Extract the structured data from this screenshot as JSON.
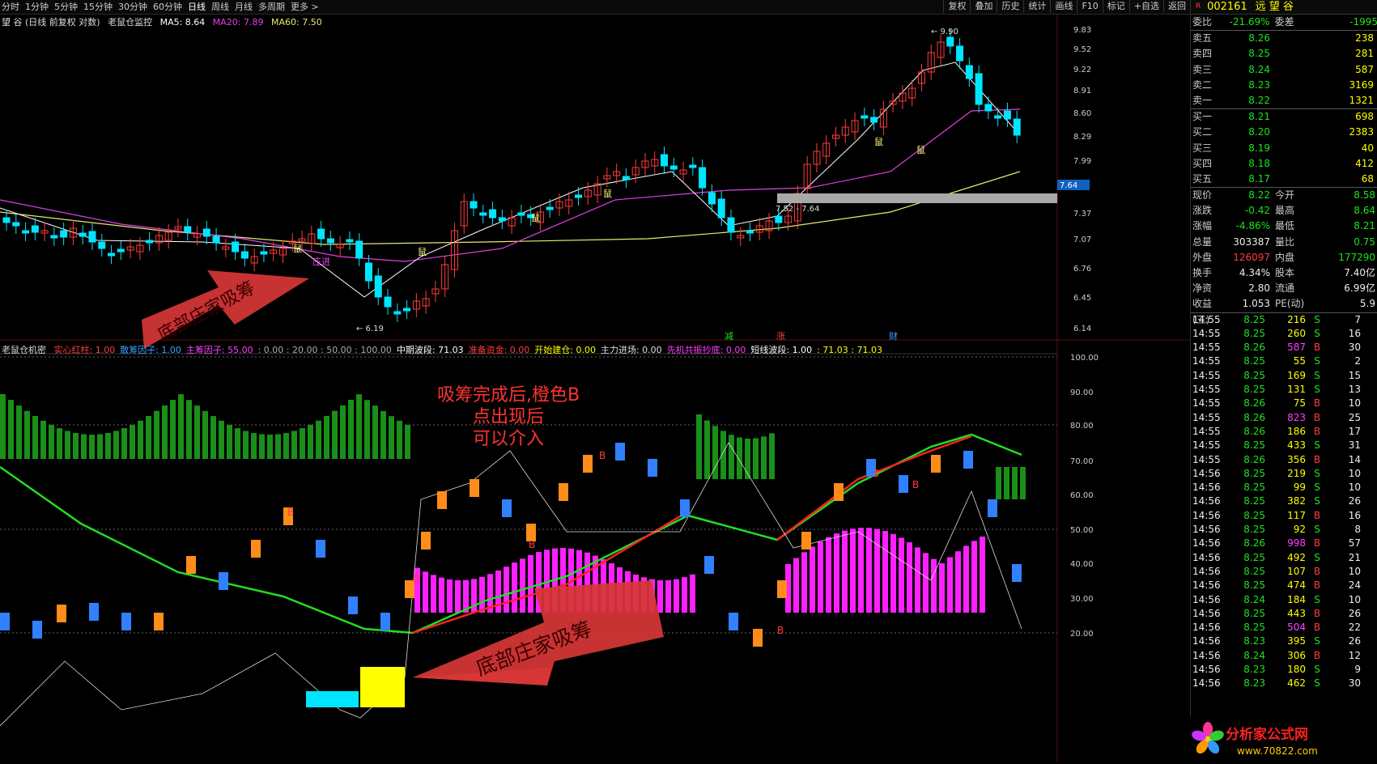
{
  "toolbar": {
    "tabs": [
      "分时",
      "1分钟",
      "5分钟",
      "15分钟",
      "30分钟",
      "60分钟",
      "日线",
      "周线",
      "月线",
      "多周期",
      "更多 >"
    ],
    "active_tab": "日线",
    "tools": [
      "复权",
      "叠加",
      "历史",
      "统计",
      "画线",
      "F10",
      "标记",
      "+自选",
      "返回"
    ]
  },
  "info": {
    "title": "望 谷 (日线 前复权 对数)",
    "indicator": "老鼠仓监控",
    "ma5": "MA5: 8.64",
    "ma20": "MA20: 7.89",
    "ma60": "MA60: 7.50"
  },
  "sub_info": {
    "name": "老鼠仓机密",
    "items": [
      {
        "t": "实心红柱: 1.00",
        "c": "#ff3c3c"
      },
      {
        "t": "散筹因子: 1.00",
        "c": "#3aa0ff"
      },
      {
        "t": "主筹因子: 55.00",
        "c": "#ff3cff"
      },
      {
        "t": ": 0.00 : 20.00 : 50.00 : 100.00",
        "c": "#aaaaaa"
      },
      {
        "t": "中期波段: 71.03",
        "c": "#ffffff"
      },
      {
        "t": "准备资金: 0.00",
        "c": "#ff3c3c"
      },
      {
        "t": "开始建仓: 0.00",
        "c": "#ffff00"
      },
      {
        "t": "主力进场: 0.00",
        "c": "#dddddd"
      },
      {
        "t": "先机共振抄底: 0.00",
        "c": "#ff3cff"
      },
      {
        "t": "短线波段: 1.00",
        "c": "#ffffff"
      },
      {
        "t": ": 71.03 : 71.03",
        "c": "#ffff00"
      }
    ]
  },
  "annotations": {
    "arrow1_text": "底部庄家吸筹",
    "arrow2_text": "底部庄家吸筹",
    "note_lines": [
      "吸筹完成后,橙色B",
      "点出现后",
      "可以介入"
    ]
  },
  "markers": {
    "rat": "鼠",
    "zhuang": "庄进",
    "low_price": "6.19",
    "high_price": "9.90",
    "range_text": "7.52 - 7.64",
    "jian": "减",
    "zhang": "涨",
    "cai": "财",
    "b": "B",
    "price_tag": "7.64"
  },
  "price_axis": [
    "9.83",
    "9.52",
    "9.22",
    "8.91",
    "8.60",
    "8.29",
    "7.99",
    "7.37",
    "7.07",
    "6.76",
    "6.45",
    "6.14"
  ],
  "ind_axis": [
    "100.00",
    "90.00",
    "80.00",
    "70.00",
    "60.00",
    "50.00",
    "40.00",
    "30.00",
    "20.00"
  ],
  "colors": {
    "up": "#ff3c3c",
    "down": "#00e5ff",
    "ma5": "#ffffff",
    "ma20": "#e040e0",
    "ma60": "#e8e870"
  },
  "quote": {
    "code": "002161",
    "name": "远 望 谷",
    "flag": "R",
    "weibi": {
      "label": "委比",
      "value": "-21.69%",
      "label2": "委差",
      "value2": "-1995"
    },
    "asks": [
      {
        "label": "卖五",
        "price": "8.26",
        "vol": "238"
      },
      {
        "label": "卖四",
        "price": "8.25",
        "vol": "281"
      },
      {
        "label": "卖三",
        "price": "8.24",
        "vol": "587"
      },
      {
        "label": "卖二",
        "price": "8.23",
        "vol": "3169"
      },
      {
        "label": "卖一",
        "price": "8.22",
        "vol": "1321"
      }
    ],
    "bids": [
      {
        "label": "买一",
        "price": "8.21",
        "vol": "698"
      },
      {
        "label": "买二",
        "price": "8.20",
        "vol": "2383"
      },
      {
        "label": "买三",
        "price": "8.19",
        "vol": "40"
      },
      {
        "label": "买四",
        "price": "8.18",
        "vol": "412"
      },
      {
        "label": "买五",
        "price": "8.17",
        "vol": "68"
      }
    ],
    "stats": [
      [
        {
          "l": "现价",
          "v": "8.22",
          "c": "g"
        },
        {
          "l": "今开",
          "v": "8.58",
          "c": "g"
        }
      ],
      [
        {
          "l": "涨跌",
          "v": "-0.42",
          "c": "g"
        },
        {
          "l": "最高",
          "v": "8.64",
          "c": "g"
        }
      ],
      [
        {
          "l": "涨幅",
          "v": "-4.86%",
          "c": "g"
        },
        {
          "l": "最低",
          "v": "8.21",
          "c": "g"
        }
      ],
      [
        {
          "l": "总量",
          "v": "303387",
          "c": "w"
        },
        {
          "l": "量比",
          "v": "0.75",
          "c": "g"
        }
      ],
      [
        {
          "l": "外盘",
          "v": "126097",
          "c": "r"
        },
        {
          "l": "内盘",
          "v": "177290",
          "c": "g"
        }
      ],
      [
        {
          "l": "换手",
          "v": "4.34%",
          "c": "w"
        },
        {
          "l": "股本",
          "v": "7.40亿",
          "c": "w"
        }
      ],
      [
        {
          "l": "净资",
          "v": "2.80",
          "c": "w"
        },
        {
          "l": "流通",
          "v": "6.99亿",
          "c": "w"
        }
      ],
      [
        {
          "l": "收益(三)",
          "v": "1.053",
          "c": "w"
        },
        {
          "l": "PE(动)",
          "v": "5.9",
          "c": "w"
        }
      ]
    ],
    "ticks": [
      [
        "14:55",
        "8.25",
        "216",
        "S",
        "7"
      ],
      [
        "14:55",
        "8.25",
        "260",
        "S",
        "16"
      ],
      [
        "14:55",
        "8.26",
        "587",
        "B",
        "30"
      ],
      [
        "14:55",
        "8.25",
        "55",
        "S",
        "2"
      ],
      [
        "14:55",
        "8.25",
        "169",
        "S",
        "15"
      ],
      [
        "14:55",
        "8.25",
        "131",
        "S",
        "13"
      ],
      [
        "14:55",
        "8.26",
        "75",
        "B",
        "10"
      ],
      [
        "14:55",
        "8.26",
        "823",
        "B",
        "25"
      ],
      [
        "14:55",
        "8.26",
        "186",
        "B",
        "17"
      ],
      [
        "14:55",
        "8.25",
        "433",
        "S",
        "31"
      ],
      [
        "14:55",
        "8.26",
        "356",
        "B",
        "14"
      ],
      [
        "14:56",
        "8.25",
        "219",
        "S",
        "10"
      ],
      [
        "14:56",
        "8.25",
        "99",
        "S",
        "10"
      ],
      [
        "14:56",
        "8.25",
        "382",
        "S",
        "26"
      ],
      [
        "14:56",
        "8.25",
        "117",
        "B",
        "16"
      ],
      [
        "14:56",
        "8.25",
        "92",
        "S",
        "8"
      ],
      [
        "14:56",
        "8.26",
        "998",
        "B",
        "57"
      ],
      [
        "14:56",
        "8.25",
        "492",
        "S",
        "21"
      ],
      [
        "14:56",
        "8.25",
        "107",
        "B",
        "10"
      ],
      [
        "14:56",
        "8.25",
        "474",
        "B",
        "24"
      ],
      [
        "14:56",
        "8.24",
        "184",
        "S",
        "10"
      ],
      [
        "14:56",
        "8.25",
        "443",
        "B",
        "26"
      ],
      [
        "14:56",
        "8.25",
        "504",
        "B",
        "22"
      ],
      [
        "14:56",
        "8.23",
        "395",
        "S",
        "26"
      ],
      [
        "14:56",
        "8.24",
        "306",
        "B",
        "12"
      ],
      [
        "14:56",
        "8.23",
        "180",
        "S",
        "9"
      ],
      [
        "14:56",
        "8.23",
        "462",
        "S",
        "30"
      ]
    ],
    "watermark": "分析家公式网",
    "watermark_url": "www.70822.com"
  }
}
